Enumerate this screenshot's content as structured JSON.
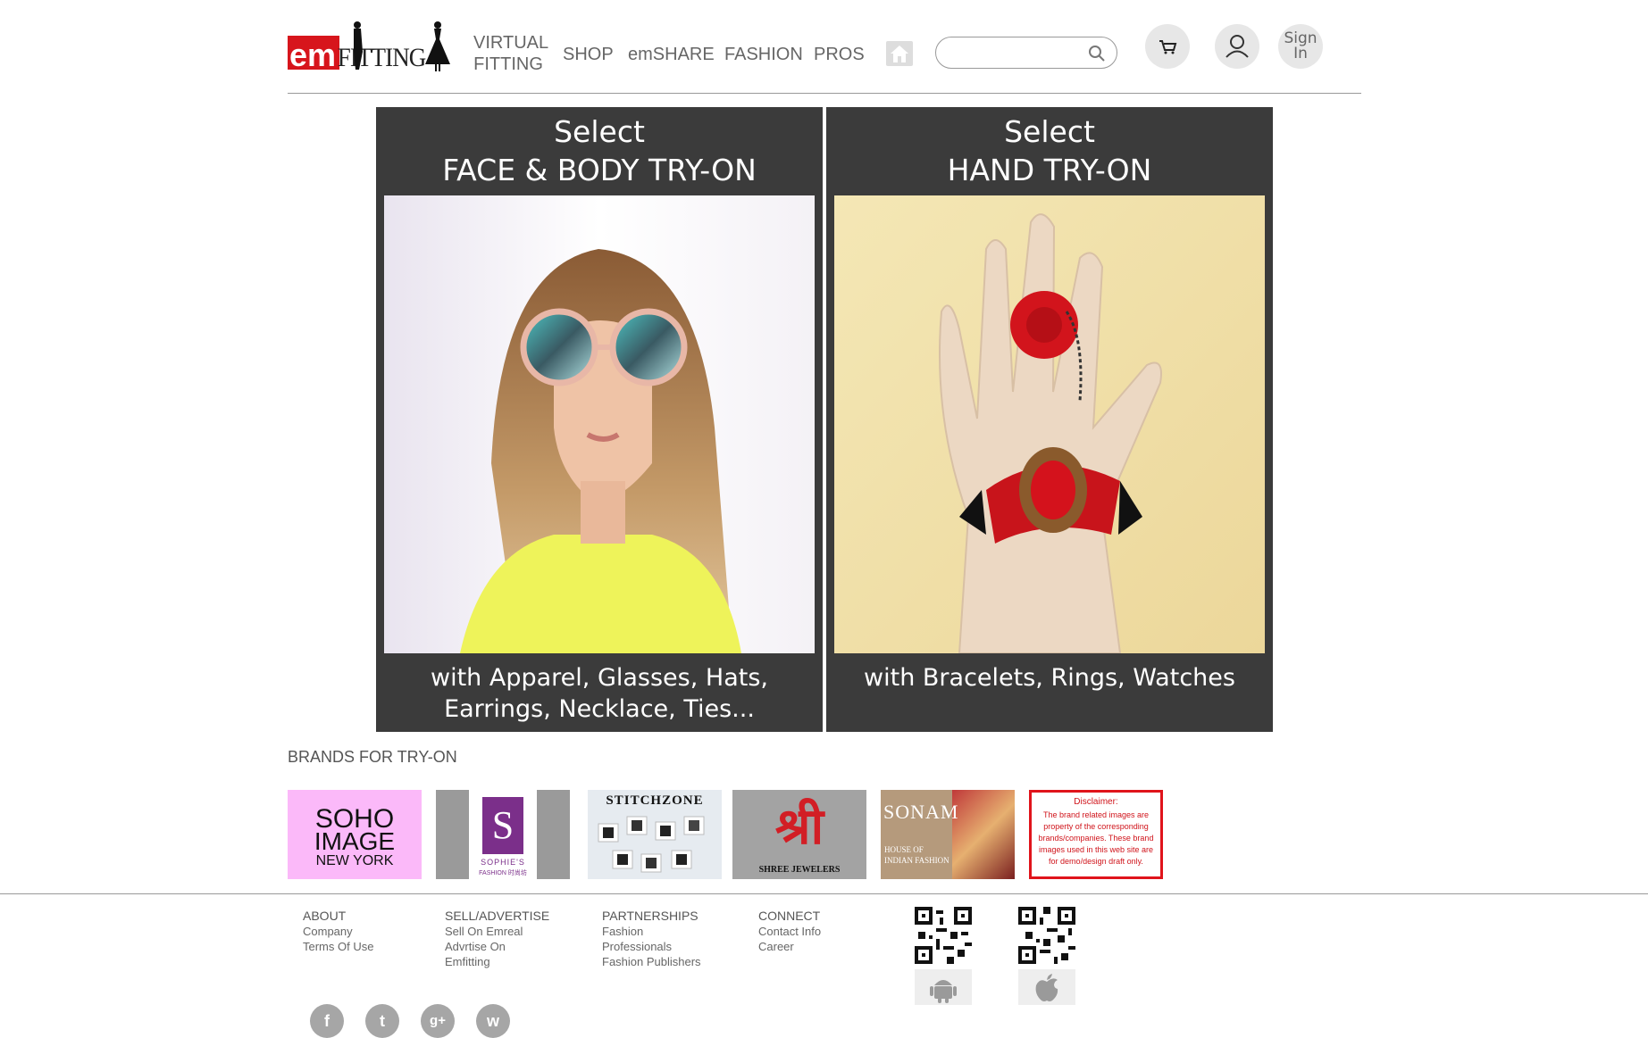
{
  "header": {
    "logo": {
      "em": "em",
      "fitting": "FITTING"
    },
    "nav": [
      {
        "label": "VIRTUAL\nFITTING"
      },
      {
        "label": "SHOP"
      },
      {
        "label": "emSHARE"
      },
      {
        "label": "FASHION"
      },
      {
        "label": "PROS"
      }
    ],
    "search": {
      "value": "",
      "placeholder": ""
    },
    "signin": "Sign In"
  },
  "panels": [
    {
      "line1": "Select",
      "line2": "FACE & BODY TRY-ON",
      "caption1": "with Apparel, Glasses, Hats,",
      "caption2": "Earrings, Necklace, Ties..."
    },
    {
      "line1": "Select",
      "line2": "HAND TRY-ON",
      "caption1": "with  Bracelets, Rings, Watches",
      "caption2": ""
    }
  ],
  "brands": {
    "title": "BRANDS FOR TRY-ON",
    "items": [
      {
        "l1": "SOHO",
        "l2": "IMAGE",
        "l3": "NEW YORK"
      },
      {
        "l1": "S",
        "l2": "SOPHIE'S",
        "l3": "FASHION 时尚坊"
      },
      {
        "l1": "STITCHZONE"
      },
      {
        "l1": "श्री",
        "l2": "SHREE JEWELERS"
      },
      {
        "l1": "SONAM",
        "l2": "HOUSE OF",
        "l3": "INDIAN FASHION"
      },
      {
        "l1": "Disclaimer:",
        "l2": "The brand related images are property of the corresponding brands/companies. These brand images used in this web site are for demo/design draft only."
      }
    ]
  },
  "footer": {
    "columns": [
      {
        "heading": "ABOUT",
        "links": [
          "Company",
          "Terms Of Use"
        ]
      },
      {
        "heading": "SELL/ADVERTISE",
        "links": [
          "Sell On Emreal",
          "Advrtise On",
          "Emfitting"
        ]
      },
      {
        "heading": "PARTNERSHIPS",
        "links": [
          "Fashion",
          "Professionals",
          "Fashion Publishers"
        ]
      },
      {
        "heading": "CONNECT",
        "links": [
          "Contact Info",
          "Career"
        ]
      }
    ],
    "social": [
      "f",
      "t",
      "g+",
      "w"
    ]
  }
}
